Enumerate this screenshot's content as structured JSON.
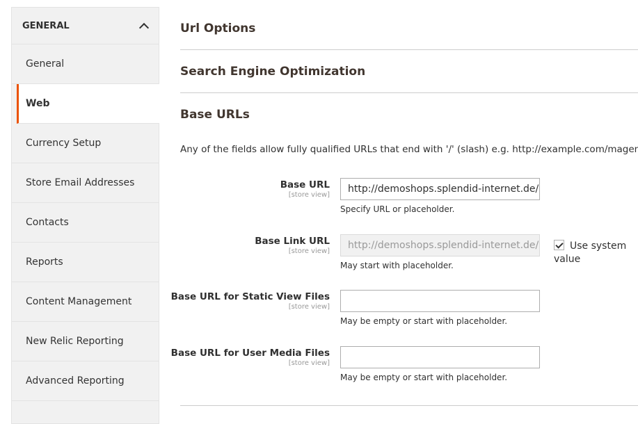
{
  "sidebar": {
    "section": "GENERAL",
    "items": [
      {
        "label": "General"
      },
      {
        "label": "Web",
        "active": true
      },
      {
        "label": "Currency Setup"
      },
      {
        "label": "Store Email Addresses"
      },
      {
        "label": "Contacts"
      },
      {
        "label": "Reports"
      },
      {
        "label": "Content Management"
      },
      {
        "label": "New Relic Reporting"
      },
      {
        "label": "Advanced Reporting"
      }
    ]
  },
  "main": {
    "sections": [
      "Url Options",
      "Search Engine Optimization",
      "Base URLs"
    ],
    "description": "Any of the fields allow fully qualified URLs that end with '/' (slash) e.g. http://example.com/magento/",
    "fields": [
      {
        "label": "Base URL",
        "scope": "[store view]",
        "value": "http://demoshops.splendid-internet.de/r",
        "note": "Specify URL or placeholder."
      },
      {
        "label": "Base Link URL",
        "scope": "[store view]",
        "value": "http://demoshops.splendid-internet.de/r",
        "note": "May start with placeholder.",
        "disabled": true,
        "use_system": "Use system value",
        "use_system_checked": true
      },
      {
        "label": "Base URL for Static View Files",
        "scope": "[store view]",
        "value": "",
        "note": "May be empty or start with placeholder."
      },
      {
        "label": "Base URL for User Media Files",
        "scope": "[store view]",
        "value": "",
        "note": "May be empty or start with placeholder."
      }
    ]
  },
  "colors": {
    "accent": "#eb5202"
  }
}
